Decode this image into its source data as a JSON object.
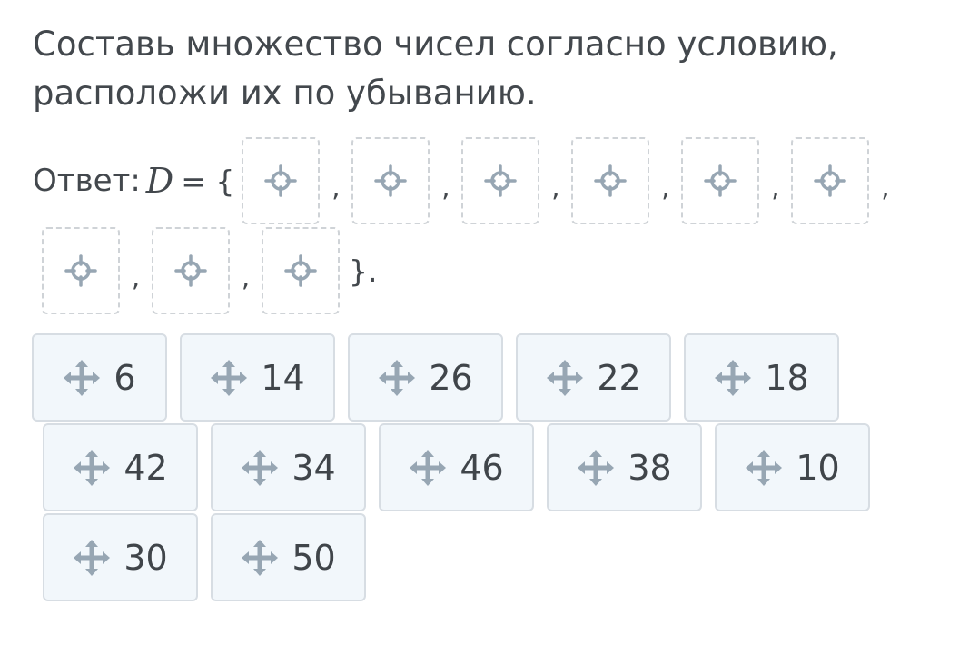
{
  "question": {
    "text": "Составь множество чисел согласно условию, расположи их по убыванию."
  },
  "answer": {
    "label": "Ответ:",
    "variable": "D",
    "equals_open": "= {",
    "separator": ",",
    "closing": "}.",
    "slot_count": 9
  },
  "tiles": [
    {
      "value": "6",
      "icon": "move-icon"
    },
    {
      "value": "14",
      "icon": "move-icon"
    },
    {
      "value": "26",
      "icon": "move-icon"
    },
    {
      "value": "22",
      "icon": "move-icon"
    },
    {
      "value": "18",
      "icon": "move-icon"
    },
    {
      "value": "42",
      "icon": "move-icon"
    },
    {
      "value": "34",
      "icon": "move-icon"
    },
    {
      "value": "46",
      "icon": "move-icon"
    },
    {
      "value": "38",
      "icon": "move-icon"
    },
    {
      "value": "10",
      "icon": "move-icon"
    },
    {
      "value": "30",
      "icon": "move-icon"
    },
    {
      "value": "50",
      "icon": "move-icon"
    }
  ],
  "colors": {
    "icon": "#97a6b3",
    "slot_border": "#cfd3d7",
    "tile_bg": "#f2f7fb",
    "tile_border": "#d7dde3",
    "text": "#43484d"
  }
}
